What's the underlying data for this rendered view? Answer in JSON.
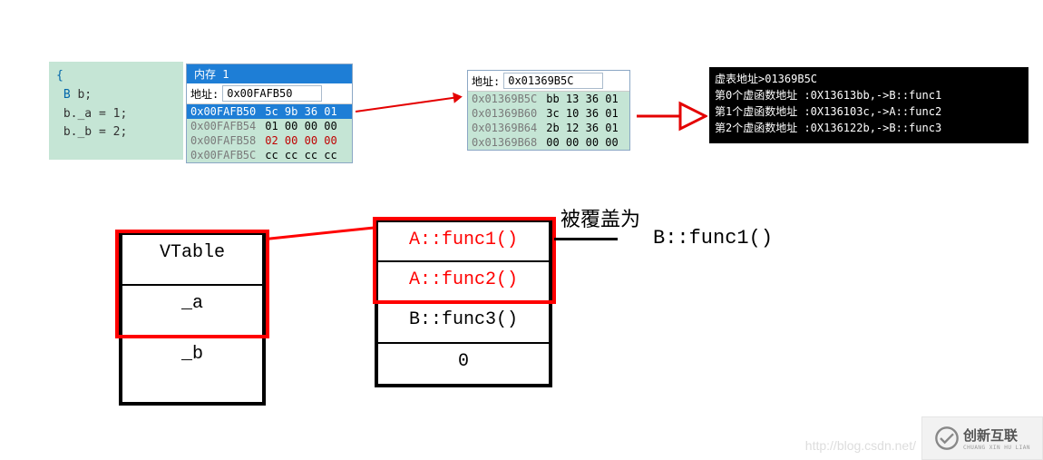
{
  "code": {
    "brace": "{",
    "line1_type": "B",
    "line1_rest": " b;",
    "line2": "b._a = 1;",
    "line3": "b._b = 2;"
  },
  "mem1": {
    "title": "内存 1",
    "addr_label": "地址:",
    "addr_value": "0x00FAFB50",
    "rows": [
      {
        "addr": "0x00FAFB50",
        "bytes": "5c 9b 36 01",
        "red": false
      },
      {
        "addr": "0x00FAFB54",
        "bytes": "01 00 00 00",
        "red": false
      },
      {
        "addr": "0x00FAFB58",
        "bytes": "02 00 00 00",
        "red": true
      },
      {
        "addr": "0x00FAFB5C",
        "bytes": "cc cc cc cc",
        "red": false
      }
    ]
  },
  "mem2": {
    "addr_label": "地址:",
    "addr_value": "0x01369B5C",
    "rows": [
      {
        "addr": "0x01369B5C",
        "bytes": "bb 13 36 01"
      },
      {
        "addr": "0x01369B60",
        "bytes": "3c 10 36 01"
      },
      {
        "addr": "0x01369B64",
        "bytes": "2b 12 36 01"
      },
      {
        "addr": "0x01369B68",
        "bytes": "00 00 00 00"
      }
    ]
  },
  "terminal": {
    "line1": "虚表地址>01369B5C",
    "line2": "第0个虚函数地址 :0X13613bb,->B::func1",
    "line3": "第1个虚函数地址 :0X136103c,->A::func2",
    "line4": "第2个虚函数地址 :0X136122b,->B::func3"
  },
  "obj": {
    "row1": "VTable",
    "row2": "_a",
    "row3": "_b"
  },
  "vtable": {
    "row1": "A::func1()",
    "row2": "A::func2()",
    "row3": "B::func3()",
    "row4": "0"
  },
  "anno": {
    "overridden_label": "被覆盖为",
    "overridden_value": "B::func1()"
  },
  "watermark": "http://blog.csdn.net/",
  "logo": {
    "text": "创新互联",
    "sub": "CHUANG XIN HU LIAN"
  }
}
